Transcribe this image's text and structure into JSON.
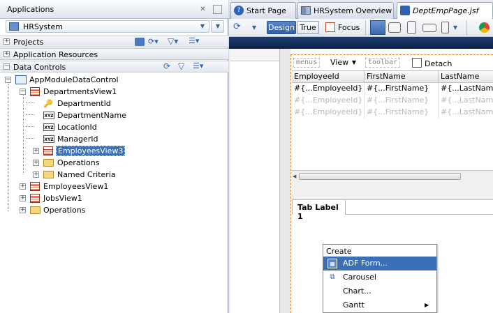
{
  "applications_panel": {
    "title": "Applications",
    "pin_label": "✕",
    "min_label": "▭",
    "project": "HRSystem",
    "sections": {
      "projects": "Projects",
      "application_resources": "Application Resources",
      "data_controls": "Data Controls"
    }
  },
  "tree": {
    "root": "AppModuleDataControl",
    "departments": "DepartmentsView1",
    "department_id": "DepartmentId",
    "department_name": "DepartmentName",
    "location_id": "LocationId",
    "manager_id": "ManagerId",
    "employees_view3": "EmployeesView3",
    "operations_inner": "Operations",
    "named_criteria": "Named Criteria",
    "employees_view1": "EmployeesView1",
    "jobs_view1": "JobsView1",
    "operations": "Operations"
  },
  "editor_tabs": [
    {
      "label": "Start Page"
    },
    {
      "label": "HRSystem Overview"
    },
    {
      "label": "DeptEmpPage.jsf"
    }
  ],
  "toolbar": {
    "design": "Design",
    "true": "True",
    "focus": "Focus"
  },
  "page_toolbar": {
    "menus": "menus",
    "view": "View",
    "toolbar": "toolbar",
    "detach": "Detach"
  },
  "table": {
    "columns": [
      "EmployeeId",
      "FirstName",
      "LastName"
    ],
    "rows": [
      [
        "#{...EmployeeId}",
        "#{...FirstName}",
        "#{...LastName}"
      ],
      [
        "#{...EmployeeId}",
        "#{...FirstName}",
        "#{...LastName}"
      ],
      [
        "#{...EmployeeId}",
        "#{...FirstName}",
        "#{...LastName}"
      ]
    ]
  },
  "tab_label": "Tab Label 1",
  "context_menu": {
    "header": "Create",
    "items": [
      {
        "label": "ADF Form..."
      },
      {
        "label": "Carousel"
      },
      {
        "label": "Chart..."
      },
      {
        "label": "Gantt"
      }
    ]
  },
  "colors": {
    "selection": "#3b6fb6",
    "design_active": "#2e5ea8",
    "dark_bar": "#0a2248",
    "page_border": "#e0802a"
  }
}
